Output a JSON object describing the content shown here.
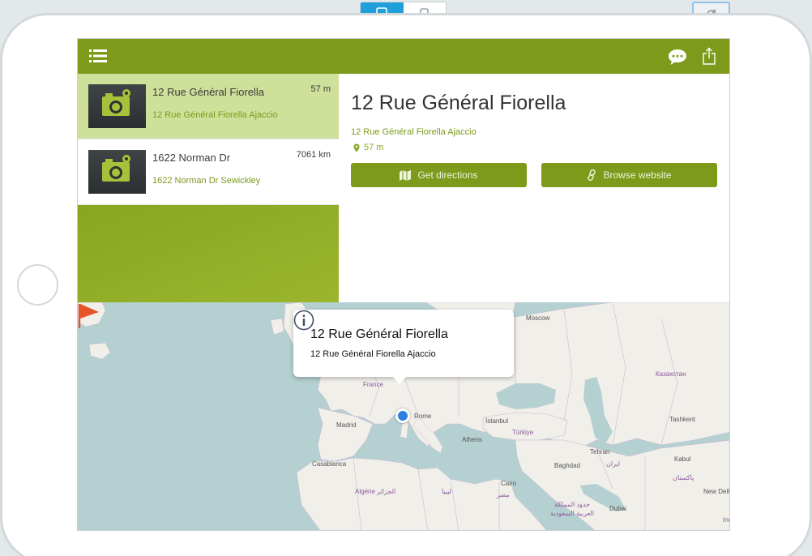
{
  "colors": {
    "accent": "#7d9a1b",
    "selected_row": "#cfe09a",
    "toggle_active": "#1fa0db",
    "pin": "#2f7fe0",
    "flag": "#e8542a"
  },
  "toolbar": {
    "icons": [
      "tablet-icon",
      "phone-icon",
      "refresh-icon"
    ],
    "active_device": "tablet"
  },
  "header": {
    "icons": [
      "menu-icon",
      "chat-icon",
      "share-icon"
    ]
  },
  "places": [
    {
      "title": "12 Rue Général Fiorella",
      "subtitle": "12 Rue Général Fiorella Ajaccio",
      "distance": "57 m",
      "icon": "camera-icon",
      "selected": true
    },
    {
      "title": "1622 Norman Dr",
      "subtitle": "1622 Norman Dr Sewickley",
      "distance": "7061 km",
      "icon": "camera-icon",
      "selected": false
    }
  ],
  "detail": {
    "title": "12 Rue Général Fiorella",
    "address": "12 Rue Général Fiorella Ajaccio",
    "distance": "57 m",
    "directions_label": "Get directions",
    "website_label": "Browse website"
  },
  "map": {
    "popup_title": "12 Rue Général Fiorella",
    "popup_subtitle": "12 Rue Général Fiorella Ajaccio",
    "labels": {
      "moscow": "Moscow",
      "kazakhstan": "Казахстан",
      "france": "France",
      "rome": "Rome",
      "madrid": "Madrid",
      "istanbul": "İstanbul",
      "turkiye": "Türkiye",
      "athens": "Athens",
      "tashkent": "Tashkent",
      "casablanca": "Casablanca",
      "tehran": "Tehran",
      "iran": "ایران",
      "baghdad": "Baghdad",
      "kabul": "Kabul",
      "pakistan": "پاکستان",
      "cairo": "Cairo",
      "algerie": "Algérie الجزائر",
      "libya": "ليبيا",
      "egypt": "مصر",
      "saudi": "حدود المملكة العربية السعودية",
      "dubai": "Dubai",
      "new_delhi": "New Delhi",
      "india": "Indi"
    }
  }
}
